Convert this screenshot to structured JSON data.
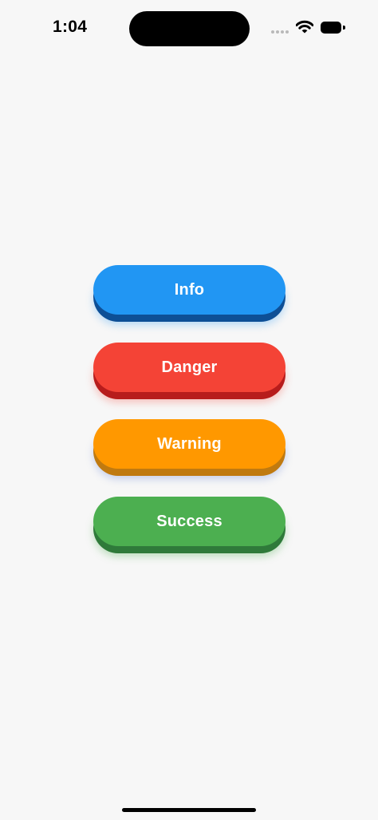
{
  "status_bar": {
    "time": "1:04"
  },
  "buttons": [
    {
      "label": "Info",
      "face_color": "#2196f3",
      "base_color": "#0d4f96",
      "glow": "rgba(33,150,243,0.30)"
    },
    {
      "label": "Danger",
      "face_color": "#f44336",
      "base_color": "#b71c1c",
      "glow": "rgba(244,67,54,0.30)"
    },
    {
      "label": "Warning",
      "face_color": "#ff9800",
      "base_color": "#c07a10",
      "glow": "rgba(90,120,210,0.30)"
    },
    {
      "label": "Success",
      "face_color": "#4caf50",
      "base_color": "#2f7a3a",
      "glow": "rgba(76,175,80,0.35)"
    }
  ]
}
